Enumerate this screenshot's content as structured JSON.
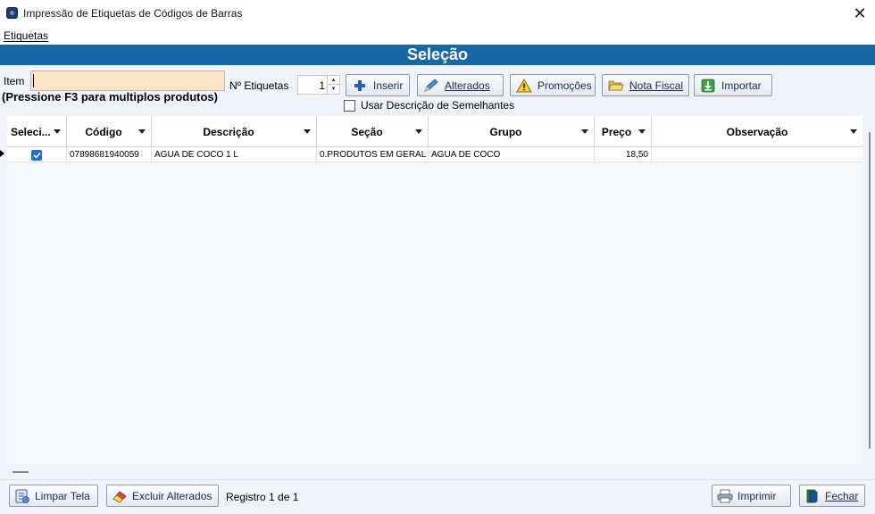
{
  "window": {
    "title": "Impressão de Etiquetas de Códigos de Barras",
    "close_glyph": "✕"
  },
  "menu": {
    "etiquetas": "Etiquetas"
  },
  "banner": {
    "title": "Seleção"
  },
  "form": {
    "item_label": "Item",
    "item_value": "",
    "hint": "(Pressione F3 para multiplos produtos)",
    "qty_label": "Nº Etiquetas",
    "qty_value": "1",
    "similar_label": "Usar Descrição de Semelhantes",
    "similar_checked": false
  },
  "toolbar": {
    "inserir": "Inserir",
    "alterados": "Alterados",
    "promocoes": "Promoções",
    "nota_fiscal": "Nota Fiscal",
    "importar": "Importar"
  },
  "grid": {
    "columns": [
      "Seleci...",
      "Código",
      "Descrição",
      "Seção",
      "Grupo",
      "Preço",
      "Observação"
    ],
    "rows": [
      {
        "selected": true,
        "codigo": "07898681940059",
        "descricao": "AGUA DE COCO 1 L",
        "secao": "0.PRODUTOS EM GERAL",
        "grupo": "AGUA DE COCO",
        "preco": "18,50",
        "observacao": ""
      }
    ]
  },
  "footer": {
    "limpar": "Limpar Tela",
    "excluir": "Excluir Alterados",
    "registro": "Registro 1 de 1",
    "imprimir": "Imprimir",
    "fechar": "Fechar"
  },
  "icons": {
    "app": "app-icon",
    "inserir": "plus-icon",
    "alterados": "pencil-icon",
    "promocoes": "warning-icon",
    "nota_fiscal": "folder-icon",
    "importar": "import-icon",
    "limpar": "clear-screen-icon",
    "excluir": "eraser-icon",
    "imprimir": "printer-icon",
    "fechar": "exit-icon"
  },
  "colors": {
    "banner": "#1868a5",
    "input_highlight": "#fde4c7",
    "checkbox_checked": "#1e6fd1"
  }
}
